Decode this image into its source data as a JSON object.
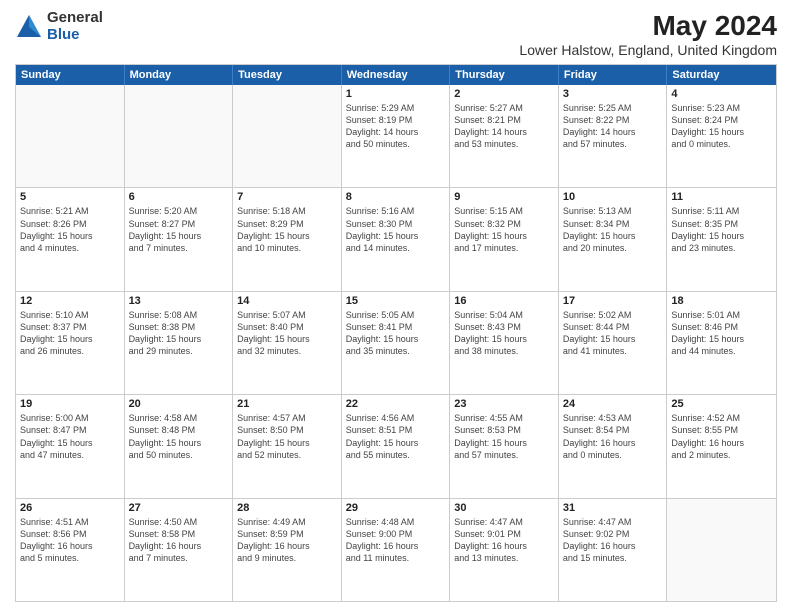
{
  "logo": {
    "general": "General",
    "blue": "Blue"
  },
  "header": {
    "month": "May 2024",
    "location": "Lower Halstow, England, United Kingdom"
  },
  "days": [
    "Sunday",
    "Monday",
    "Tuesday",
    "Wednesday",
    "Thursday",
    "Friday",
    "Saturday"
  ],
  "weeks": [
    [
      {
        "day": "",
        "lines": [],
        "empty": true
      },
      {
        "day": "",
        "lines": [],
        "empty": true
      },
      {
        "day": "",
        "lines": [],
        "empty": true
      },
      {
        "day": "1",
        "lines": [
          "Sunrise: 5:29 AM",
          "Sunset: 8:19 PM",
          "Daylight: 14 hours",
          "and 50 minutes."
        ],
        "empty": false
      },
      {
        "day": "2",
        "lines": [
          "Sunrise: 5:27 AM",
          "Sunset: 8:21 PM",
          "Daylight: 14 hours",
          "and 53 minutes."
        ],
        "empty": false
      },
      {
        "day": "3",
        "lines": [
          "Sunrise: 5:25 AM",
          "Sunset: 8:22 PM",
          "Daylight: 14 hours",
          "and 57 minutes."
        ],
        "empty": false
      },
      {
        "day": "4",
        "lines": [
          "Sunrise: 5:23 AM",
          "Sunset: 8:24 PM",
          "Daylight: 15 hours",
          "and 0 minutes."
        ],
        "empty": false
      }
    ],
    [
      {
        "day": "5",
        "lines": [
          "Sunrise: 5:21 AM",
          "Sunset: 8:26 PM",
          "Daylight: 15 hours",
          "and 4 minutes."
        ],
        "empty": false
      },
      {
        "day": "6",
        "lines": [
          "Sunrise: 5:20 AM",
          "Sunset: 8:27 PM",
          "Daylight: 15 hours",
          "and 7 minutes."
        ],
        "empty": false
      },
      {
        "day": "7",
        "lines": [
          "Sunrise: 5:18 AM",
          "Sunset: 8:29 PM",
          "Daylight: 15 hours",
          "and 10 minutes."
        ],
        "empty": false
      },
      {
        "day": "8",
        "lines": [
          "Sunrise: 5:16 AM",
          "Sunset: 8:30 PM",
          "Daylight: 15 hours",
          "and 14 minutes."
        ],
        "empty": false
      },
      {
        "day": "9",
        "lines": [
          "Sunrise: 5:15 AM",
          "Sunset: 8:32 PM",
          "Daylight: 15 hours",
          "and 17 minutes."
        ],
        "empty": false
      },
      {
        "day": "10",
        "lines": [
          "Sunrise: 5:13 AM",
          "Sunset: 8:34 PM",
          "Daylight: 15 hours",
          "and 20 minutes."
        ],
        "empty": false
      },
      {
        "day": "11",
        "lines": [
          "Sunrise: 5:11 AM",
          "Sunset: 8:35 PM",
          "Daylight: 15 hours",
          "and 23 minutes."
        ],
        "empty": false
      }
    ],
    [
      {
        "day": "12",
        "lines": [
          "Sunrise: 5:10 AM",
          "Sunset: 8:37 PM",
          "Daylight: 15 hours",
          "and 26 minutes."
        ],
        "empty": false
      },
      {
        "day": "13",
        "lines": [
          "Sunrise: 5:08 AM",
          "Sunset: 8:38 PM",
          "Daylight: 15 hours",
          "and 29 minutes."
        ],
        "empty": false
      },
      {
        "day": "14",
        "lines": [
          "Sunrise: 5:07 AM",
          "Sunset: 8:40 PM",
          "Daylight: 15 hours",
          "and 32 minutes."
        ],
        "empty": false
      },
      {
        "day": "15",
        "lines": [
          "Sunrise: 5:05 AM",
          "Sunset: 8:41 PM",
          "Daylight: 15 hours",
          "and 35 minutes."
        ],
        "empty": false
      },
      {
        "day": "16",
        "lines": [
          "Sunrise: 5:04 AM",
          "Sunset: 8:43 PM",
          "Daylight: 15 hours",
          "and 38 minutes."
        ],
        "empty": false
      },
      {
        "day": "17",
        "lines": [
          "Sunrise: 5:02 AM",
          "Sunset: 8:44 PM",
          "Daylight: 15 hours",
          "and 41 minutes."
        ],
        "empty": false
      },
      {
        "day": "18",
        "lines": [
          "Sunrise: 5:01 AM",
          "Sunset: 8:46 PM",
          "Daylight: 15 hours",
          "and 44 minutes."
        ],
        "empty": false
      }
    ],
    [
      {
        "day": "19",
        "lines": [
          "Sunrise: 5:00 AM",
          "Sunset: 8:47 PM",
          "Daylight: 15 hours",
          "and 47 minutes."
        ],
        "empty": false
      },
      {
        "day": "20",
        "lines": [
          "Sunrise: 4:58 AM",
          "Sunset: 8:48 PM",
          "Daylight: 15 hours",
          "and 50 minutes."
        ],
        "empty": false
      },
      {
        "day": "21",
        "lines": [
          "Sunrise: 4:57 AM",
          "Sunset: 8:50 PM",
          "Daylight: 15 hours",
          "and 52 minutes."
        ],
        "empty": false
      },
      {
        "day": "22",
        "lines": [
          "Sunrise: 4:56 AM",
          "Sunset: 8:51 PM",
          "Daylight: 15 hours",
          "and 55 minutes."
        ],
        "empty": false
      },
      {
        "day": "23",
        "lines": [
          "Sunrise: 4:55 AM",
          "Sunset: 8:53 PM",
          "Daylight: 15 hours",
          "and 57 minutes."
        ],
        "empty": false
      },
      {
        "day": "24",
        "lines": [
          "Sunrise: 4:53 AM",
          "Sunset: 8:54 PM",
          "Daylight: 16 hours",
          "and 0 minutes."
        ],
        "empty": false
      },
      {
        "day": "25",
        "lines": [
          "Sunrise: 4:52 AM",
          "Sunset: 8:55 PM",
          "Daylight: 16 hours",
          "and 2 minutes."
        ],
        "empty": false
      }
    ],
    [
      {
        "day": "26",
        "lines": [
          "Sunrise: 4:51 AM",
          "Sunset: 8:56 PM",
          "Daylight: 16 hours",
          "and 5 minutes."
        ],
        "empty": false
      },
      {
        "day": "27",
        "lines": [
          "Sunrise: 4:50 AM",
          "Sunset: 8:58 PM",
          "Daylight: 16 hours",
          "and 7 minutes."
        ],
        "empty": false
      },
      {
        "day": "28",
        "lines": [
          "Sunrise: 4:49 AM",
          "Sunset: 8:59 PM",
          "Daylight: 16 hours",
          "and 9 minutes."
        ],
        "empty": false
      },
      {
        "day": "29",
        "lines": [
          "Sunrise: 4:48 AM",
          "Sunset: 9:00 PM",
          "Daylight: 16 hours",
          "and 11 minutes."
        ],
        "empty": false
      },
      {
        "day": "30",
        "lines": [
          "Sunrise: 4:47 AM",
          "Sunset: 9:01 PM",
          "Daylight: 16 hours",
          "and 13 minutes."
        ],
        "empty": false
      },
      {
        "day": "31",
        "lines": [
          "Sunrise: 4:47 AM",
          "Sunset: 9:02 PM",
          "Daylight: 16 hours",
          "and 15 minutes."
        ],
        "empty": false
      },
      {
        "day": "",
        "lines": [],
        "empty": true
      }
    ]
  ]
}
